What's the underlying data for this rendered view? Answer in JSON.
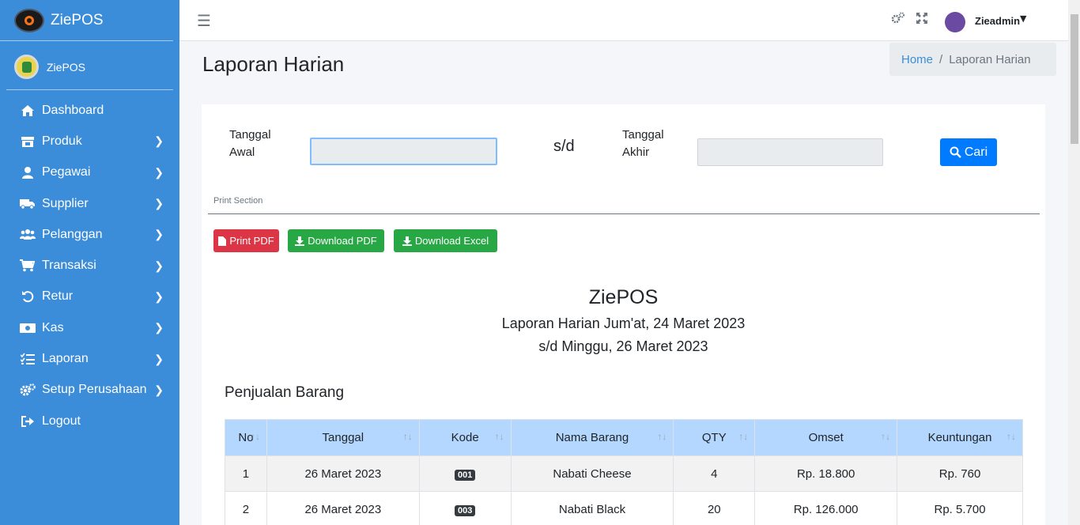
{
  "brand": {
    "name": "ZiePOS"
  },
  "user_panel": {
    "name": "ZiePOS"
  },
  "sidebar": {
    "items": [
      {
        "label": "Dashboard",
        "icon": "home-icon",
        "has_children": false
      },
      {
        "label": "Produk",
        "icon": "store-icon",
        "has_children": true
      },
      {
        "label": "Pegawai",
        "icon": "user-icon",
        "has_children": true
      },
      {
        "label": "Supplier",
        "icon": "truck-icon",
        "has_children": true
      },
      {
        "label": "Pelanggan",
        "icon": "users-icon",
        "has_children": true
      },
      {
        "label": "Transaksi",
        "icon": "cart-icon",
        "has_children": true
      },
      {
        "label": "Retur",
        "icon": "undo-icon",
        "has_children": true
      },
      {
        "label": "Kas",
        "icon": "money-icon",
        "has_children": true
      },
      {
        "label": "Laporan",
        "icon": "list-check-icon",
        "has_children": true
      },
      {
        "label": "Setup Perusahaan",
        "icon": "cogs-icon",
        "has_children": true
      },
      {
        "label": "Logout",
        "icon": "logout-icon",
        "has_children": false
      }
    ]
  },
  "topbar": {
    "admin_name": "Zieadmin"
  },
  "header": {
    "title": "Laporan Harian"
  },
  "breadcrumb": {
    "home": "Home",
    "current": "Laporan Harian"
  },
  "filter": {
    "start_label_1": "Tanggal",
    "start_label_2": "Awal",
    "start_value": "",
    "separator": "s/d",
    "end_label_1": "Tanggal",
    "end_label_2": "Akhir",
    "end_value": "",
    "search_label": "Cari"
  },
  "print_section": {
    "label": "Print Section",
    "print_pdf": "Print PDF",
    "download_pdf": "Download PDF",
    "download_excel": "Download Excel"
  },
  "report": {
    "company": "ZiePOS",
    "subtitle": "Laporan Harian Jum'at, 24 Maret 2023",
    "subtitle2": "s/d Minggu, 26 Maret 2023",
    "section_title": "Penjualan Barang"
  },
  "table": {
    "headers": [
      "No",
      "Tanggal",
      "Kode",
      "Nama Barang",
      "QTY",
      "Omset",
      "Keuntungan"
    ],
    "rows": [
      {
        "no": "1",
        "tanggal": "26 Maret 2023",
        "kode": "001",
        "nama": "Nabati Cheese",
        "qty": "4",
        "omset": "Rp. 18.800",
        "keuntungan": "Rp. 760"
      },
      {
        "no": "2",
        "tanggal": "26 Maret 2023",
        "kode": "003",
        "nama": "Nabati Black",
        "qty": "20",
        "omset": "Rp. 126.000",
        "keuntungan": "Rp. 5.700"
      }
    ]
  },
  "colors": {
    "sidebar": "#3c8dd9",
    "primary": "#007bff",
    "danger": "#dc3545",
    "success": "#28a745",
    "table_header": "#b3d7ff"
  }
}
